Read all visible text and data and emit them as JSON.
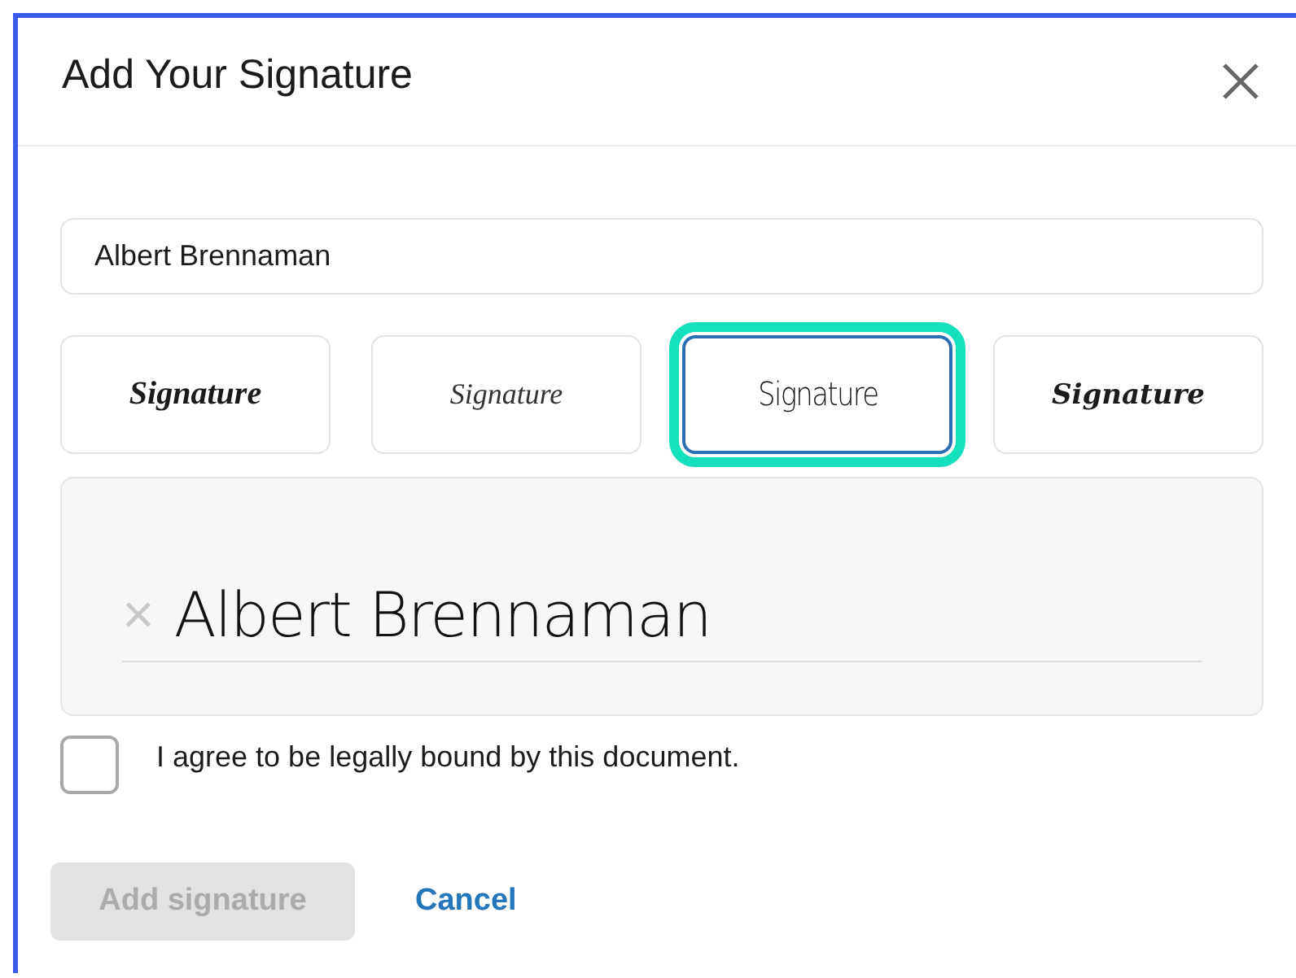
{
  "dialog": {
    "title": "Add Your Signature"
  },
  "name_field": {
    "value": "Albert Brennaman"
  },
  "styles": [
    {
      "label": "Signature",
      "kind": "bold",
      "selected": false
    },
    {
      "label": "Signature",
      "kind": "light",
      "selected": false
    },
    {
      "label": "Signature",
      "kind": "thin",
      "selected": true
    },
    {
      "label": "Signature",
      "kind": "heavy",
      "selected": false
    }
  ],
  "preview": {
    "text": "Albert Brennaman",
    "clear_icon": "×"
  },
  "agreement": {
    "label": "I agree to be legally bound by this document.",
    "checked": false
  },
  "actions": {
    "primary": {
      "label": "Add signature",
      "disabled": true
    },
    "secondary": {
      "label": "Cancel"
    }
  }
}
